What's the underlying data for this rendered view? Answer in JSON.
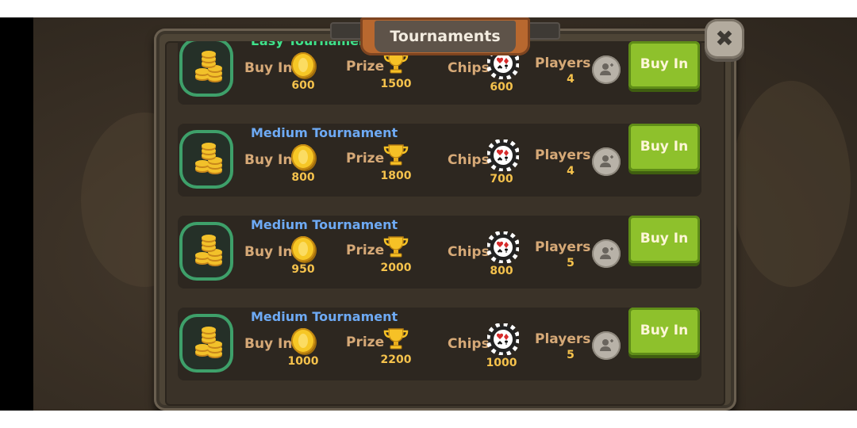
{
  "header": {
    "title": "Tournaments",
    "close_icon": "close-icon"
  },
  "labels": {
    "buy_in": "Buy In",
    "prize": "Prize",
    "chips": "Chips",
    "players": "Players",
    "buy_button": "Buy In"
  },
  "tournaments": [
    {
      "name": "Easy Tournament",
      "name_color": "#3fe38b",
      "buy_in": "600",
      "prize": "1500",
      "chips": "600",
      "players": "4"
    },
    {
      "name": "Medium Tournament",
      "name_color": "#6eaaf4",
      "buy_in": "800",
      "prize": "1800",
      "chips": "700",
      "players": "4"
    },
    {
      "name": "Medium Tournament",
      "name_color": "#6eaaf4",
      "buy_in": "950",
      "prize": "2000",
      "chips": "800",
      "players": "5"
    },
    {
      "name": "Medium Tournament",
      "name_color": "#6eaaf4",
      "buy_in": "1000",
      "prize": "2200",
      "chips": "1000",
      "players": "5"
    }
  ],
  "colors": {
    "accent_green": "#8ec12c",
    "label_tan": "#d6a977",
    "value_gold": "#f5c24c"
  }
}
